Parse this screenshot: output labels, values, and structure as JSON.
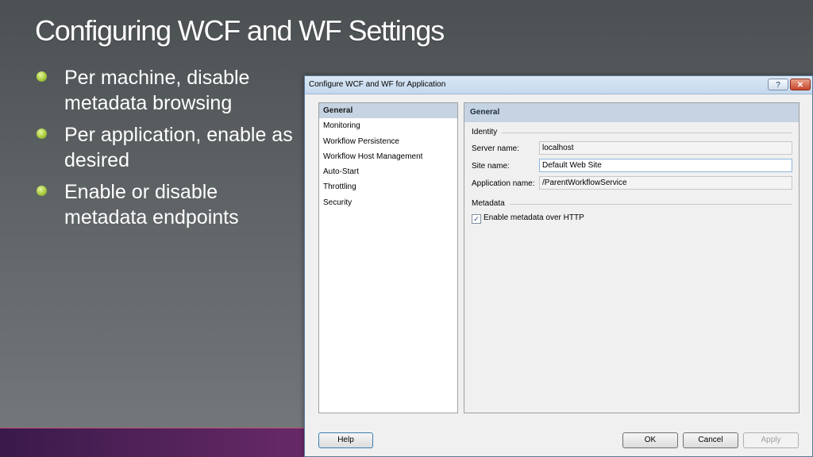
{
  "slide": {
    "title": "Configuring WCF and WF Settings",
    "bullets": [
      "Per machine, disable metadata browsing",
      "Per application, enable as desired",
      "Enable or disable metadata endpoints"
    ]
  },
  "dialog": {
    "title": "Configure WCF and WF for Application",
    "help_glyph": "?",
    "close_glyph": "✕",
    "nav_items": [
      "General",
      "Monitoring",
      "Workflow Persistence",
      "Workflow Host Management",
      "Auto-Start",
      "Throttling",
      "Security"
    ],
    "selected_nav": "General",
    "panel_header": "General",
    "identity": {
      "group_label": "Identity",
      "server_label": "Server name:",
      "server_value": "localhost",
      "site_label": "Site name:",
      "site_value": "Default Web Site",
      "app_label": "Application name:",
      "app_value": "/ParentWorkflowService"
    },
    "metadata": {
      "group_label": "Metadata",
      "checkbox_label": "Enable metadata over HTTP",
      "checked": true,
      "check_glyph": "✓"
    },
    "buttons": {
      "help": "Help",
      "ok": "OK",
      "cancel": "Cancel",
      "apply": "Apply"
    }
  },
  "colors": {
    "bullet": "#a8cc3c",
    "selection": "#c6d3e2",
    "bottom_band": "#5a2260"
  }
}
